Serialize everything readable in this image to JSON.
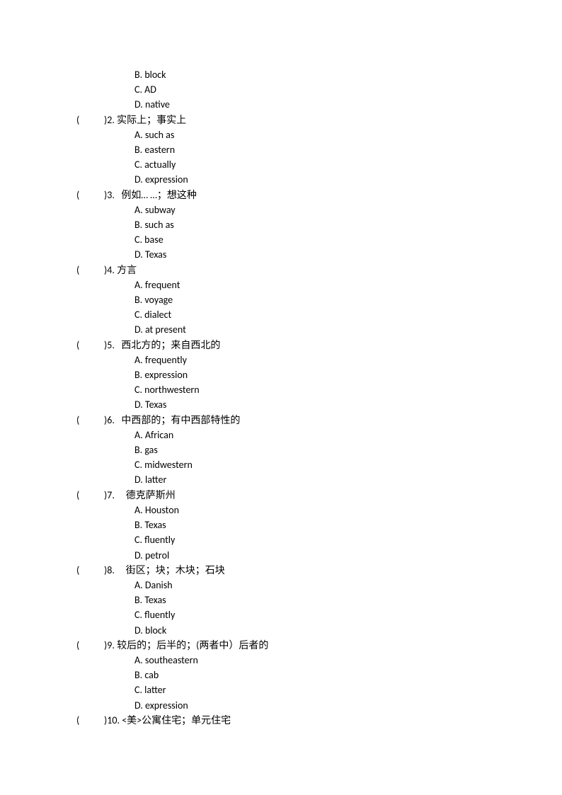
{
  "orphan_options": [
    "B. block",
    "C. AD",
    "D. native"
  ],
  "questions": [
    {
      "num": "2",
      "prompt": "实际上；事实上",
      "options": [
        "A. such as",
        "B. eastern",
        "C. actually",
        "D. expression"
      ]
    },
    {
      "num": "3",
      "prompt": "  例如… …；想这种",
      "options": [
        "A. subway",
        "B. such as",
        "C. base",
        "D. Texas"
      ]
    },
    {
      "num": "4",
      "prompt": "方言",
      "options": [
        "A. frequent",
        "B. voyage",
        "C. dialect",
        "D. at present"
      ]
    },
    {
      "num": "5",
      "prompt": "  西北方的；来自西北的",
      "options": [
        "A. frequently",
        "B. expression",
        "C. northwestern",
        "D. Texas"
      ]
    },
    {
      "num": "6",
      "prompt": "  中西部的；有中西部特性的",
      "options": [
        "A. African",
        "B. gas",
        "C. midwestern",
        "D. latter"
      ]
    },
    {
      "num": "7",
      "prompt": "    德克萨斯州",
      "options": [
        "A. Houston",
        "B. Texas",
        "C. fluently",
        "D. petrol"
      ]
    },
    {
      "num": "8",
      "prompt": "    街区；块；木块；石块",
      "options": [
        "A. Danish",
        "B. Texas",
        "C. fluently",
        "D. block"
      ]
    },
    {
      "num": "9",
      "prompt": "较后的；后半的；(两者中）后者的",
      "options": [
        "A. southeastern",
        "B. cab",
        "C. latter",
        "D. expression"
      ]
    },
    {
      "num": "10",
      "prompt": "<美>公寓住宅；单元住宅",
      "options": []
    }
  ]
}
